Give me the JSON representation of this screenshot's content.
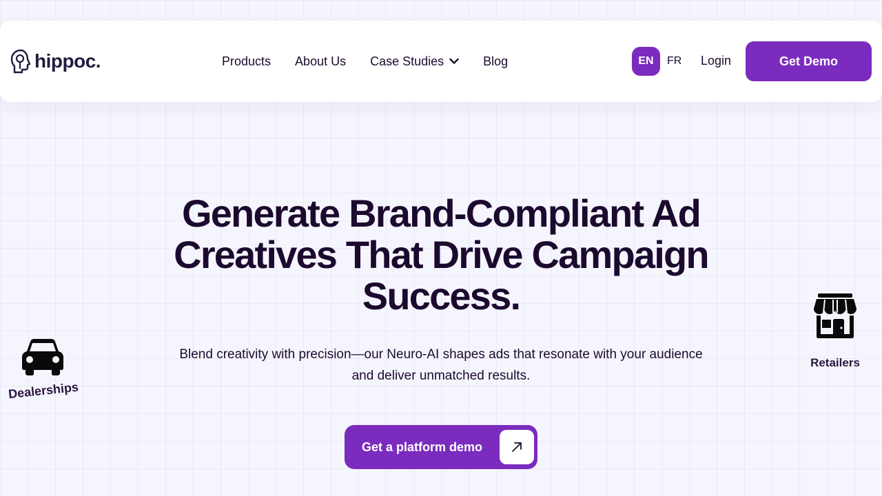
{
  "brand": {
    "name": "hippoc."
  },
  "nav": {
    "links": [
      "Products",
      "About Us",
      "Case Studies",
      "Blog"
    ],
    "lang_active": "EN",
    "lang_other": "FR",
    "login": "Login",
    "cta": "Get Demo"
  },
  "hero": {
    "title": "Generate Brand-Compliant Ad Creatives That Drive Campaign Success.",
    "subtitle": "Blend creativity with precision—our Neuro-AI shapes ads that resonate with your audience and deliver unmatched results.",
    "cta": "Get a platform demo"
  },
  "floating": {
    "left_label": "Dealerships",
    "right_label": "Retailers"
  },
  "colors": {
    "accent": "#7b2cbf",
    "text": "#1c0a2e",
    "background": "#f5f5fd"
  },
  "icons": [
    "car-icon",
    "store-icon",
    "chevron-down-icon",
    "arrow-up-right-icon",
    "head-logo-icon"
  ]
}
